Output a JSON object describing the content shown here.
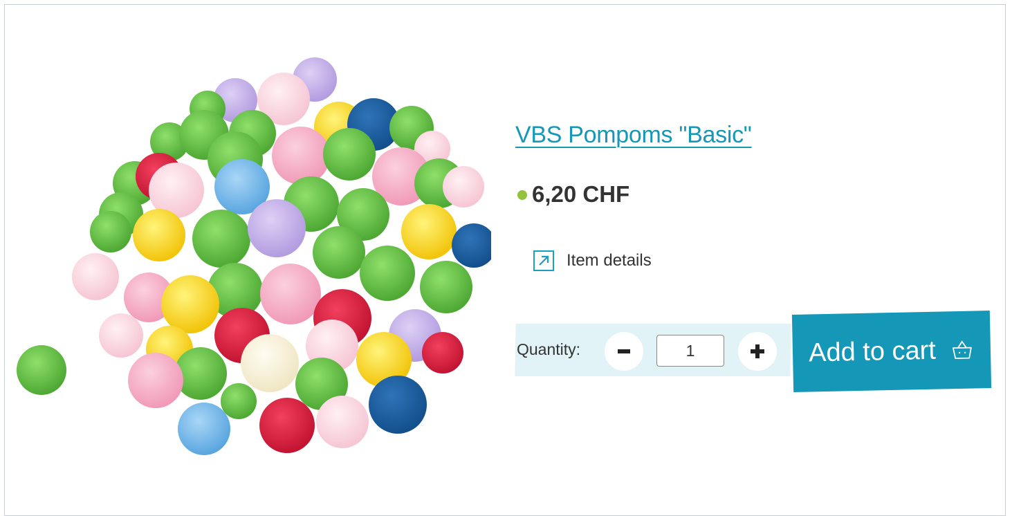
{
  "product": {
    "title": "VBS Pompoms \"Basic\"",
    "price": "6,20 CHF",
    "availability_color": "#93c23c",
    "details_label": "Item details",
    "quantity_label": "Quantity:",
    "quantity_value": "1",
    "add_to_cart_label": "Add to cart",
    "accent_color": "#1597b8"
  },
  "icons": {
    "details": "external-arrow-icon",
    "decrease": "minus-icon",
    "increase": "plus-icon",
    "cart": "basket-icon"
  }
}
